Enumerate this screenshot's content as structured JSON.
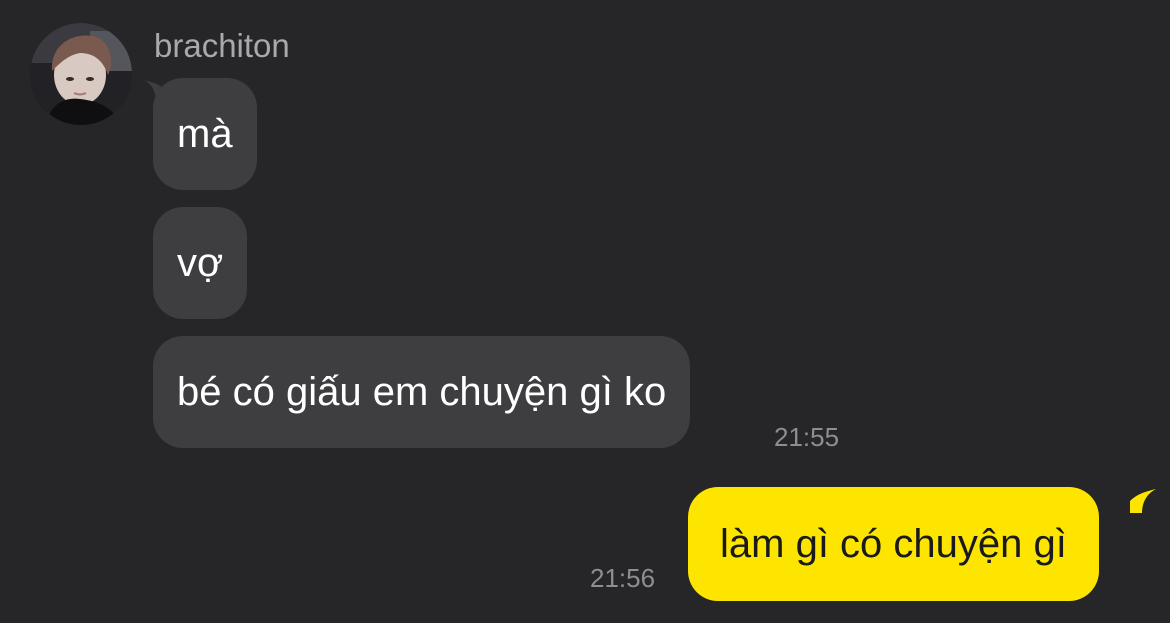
{
  "conversation": {
    "sender": {
      "name": "brachiton",
      "avatar": "profile-photo"
    },
    "incoming": [
      {
        "text": "mà"
      },
      {
        "text": "vợ"
      },
      {
        "text": "bé có giấu em chuyện gì ko",
        "time": "21:55"
      }
    ],
    "outgoing": [
      {
        "text": "làm gì có chuyện gì",
        "time": "21:56"
      }
    ]
  },
  "colors": {
    "background": "#262628",
    "incoming_bubble": "#3e3e41",
    "outgoing_bubble": "#fde500",
    "timestamp": "#8d8d92",
    "sender_name": "#a9a9ad"
  }
}
